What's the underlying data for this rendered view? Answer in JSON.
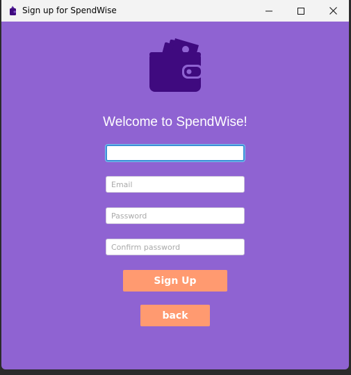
{
  "window": {
    "title": "Sign up for SpendWise"
  },
  "icons": {
    "app": "wallet-icon",
    "logo": "wallet-with-cash-icon",
    "minimize": "minimize-icon",
    "maximize": "maximize-icon",
    "close": "close-icon"
  },
  "colors": {
    "background": "#8f63d2",
    "logo": "#3f0a7f",
    "button": "#ff9a70",
    "focus_border": "#3d8fd6"
  },
  "form": {
    "heading": "Welcome to SpendWise!",
    "username": {
      "value": "",
      "placeholder": ""
    },
    "email": {
      "value": "",
      "placeholder": "Email"
    },
    "password": {
      "value": "",
      "placeholder": "Password"
    },
    "confirm_password": {
      "value": "",
      "placeholder": "Confirm password"
    },
    "signup_label": "Sign Up",
    "back_label": "back"
  }
}
